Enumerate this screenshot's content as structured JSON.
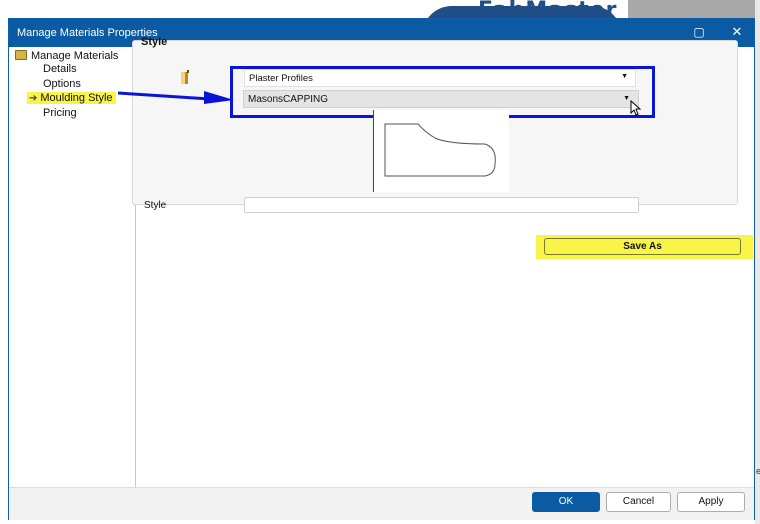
{
  "window": {
    "title": "Manage Materials Properties",
    "maximize_glyph": "▢",
    "close_glyph": "✕"
  },
  "background": {
    "logo_text": "FabMaster",
    "right_edge_text": "e"
  },
  "tree": {
    "root": "Manage Materials",
    "items": [
      {
        "label": "Details"
      },
      {
        "label": "Options"
      },
      {
        "label": "Moulding Style",
        "selected": true
      },
      {
        "label": "Pricing"
      }
    ],
    "selected_arrow": "➔"
  },
  "style_group": {
    "title": "Style",
    "category_value": "Plaster Profiles",
    "profile_value": "MasonsCAPPING",
    "style_field_label": "Style",
    "style_field_value": ""
  },
  "buttons": {
    "save_as": "Save As",
    "ok": "OK",
    "cancel": "Cancel",
    "apply": "Apply"
  },
  "colors": {
    "titlebar": "#0b5aa4",
    "highlight_yellow": "#f8f44a",
    "annotation_blue": "#0a14d8"
  },
  "icons": {
    "folder": "folder-icon",
    "style_icon": "paint-brush-icon",
    "dropdown": "chevron-down-icon"
  }
}
